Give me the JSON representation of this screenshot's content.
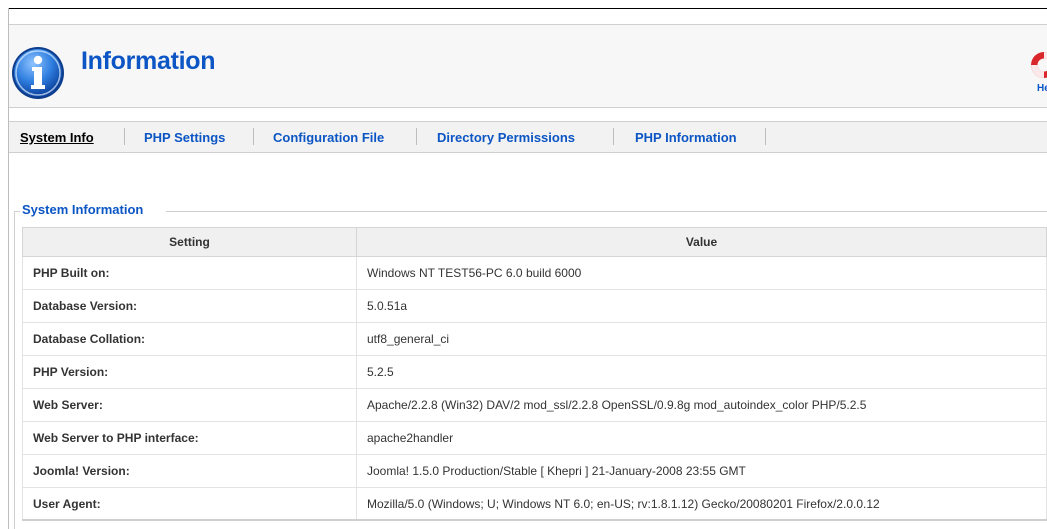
{
  "header": {
    "title": "Information",
    "help_label": "Help",
    "icon": "info-icon",
    "help_icon": "lifebuoy-icon"
  },
  "tabs": [
    {
      "label": "System Info",
      "active": true
    },
    {
      "label": "PHP Settings",
      "active": false
    },
    {
      "label": "Configuration File",
      "active": false
    },
    {
      "label": "Directory Permissions",
      "active": false
    },
    {
      "label": "PHP Information",
      "active": false
    }
  ],
  "section": {
    "legend": "System Information",
    "columns": {
      "setting": "Setting",
      "value": "Value"
    },
    "rows": [
      {
        "setting": "PHP Built on:",
        "value": "Windows NT TEST56-PC 6.0 build 6000"
      },
      {
        "setting": "Database Version:",
        "value": "5.0.51a"
      },
      {
        "setting": "Database Collation:",
        "value": "utf8_general_ci"
      },
      {
        "setting": "PHP Version:",
        "value": "5.2.5"
      },
      {
        "setting": "Web Server:",
        "value": "Apache/2.2.8 (Win32) DAV/2 mod_ssl/2.2.8 OpenSSL/0.9.8g mod_autoindex_color PHP/5.2.5"
      },
      {
        "setting": "Web Server to PHP interface:",
        "value": "apache2handler"
      },
      {
        "setting": "Joomla! Version:",
        "value": "Joomla! 1.5.0 Production/Stable [ Khepri ] 21-January-2008 23:55 GMT"
      },
      {
        "setting": "User Agent:",
        "value": "Mozilla/5.0 (Windows; U; Windows NT 6.0; en-US; rv:1.8.1.12) Gecko/20080201 Firefox/2.0.0.12"
      }
    ]
  },
  "colors": {
    "accent": "#0b55c4",
    "header_bg": "#f7f7f7",
    "table_head_bg": "#f0f0f0"
  }
}
